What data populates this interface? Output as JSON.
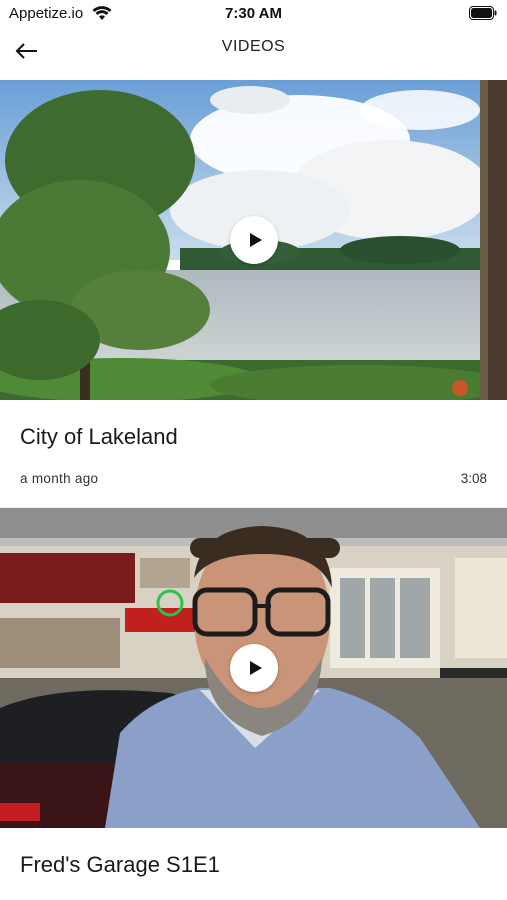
{
  "status_bar": {
    "carrier": "Appetize.io",
    "time": "7:30 AM",
    "wifi_icon": "wifi-icon",
    "battery_icon": "battery-icon"
  },
  "header": {
    "title": "VIDEOS",
    "back_icon": "arrow-left-icon"
  },
  "videos": [
    {
      "title": "City of Lakeland",
      "date": "a month ago",
      "duration": "3:08",
      "thumbnail": "lake-landscape",
      "play_icon": "play-icon"
    },
    {
      "title": "Fred's Garage S1E1",
      "date": "",
      "duration": "",
      "thumbnail": "man-in-garage",
      "play_icon": "play-icon"
    }
  ]
}
